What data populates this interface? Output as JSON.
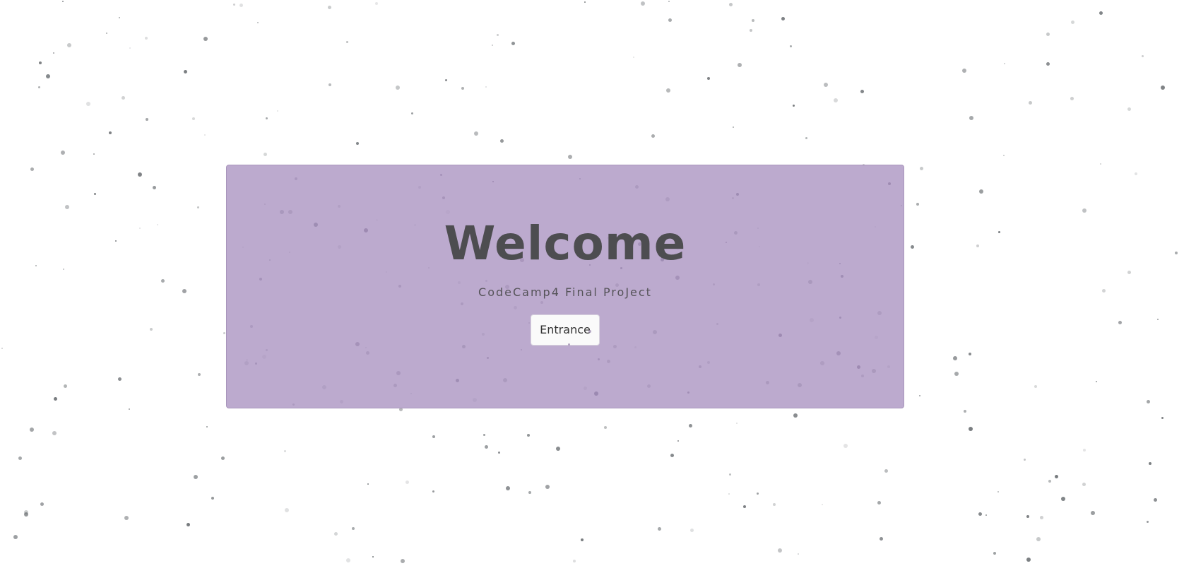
{
  "welcome": {
    "title": "Welcome",
    "subtitle": "CodeCamp4 Final ProJect",
    "button_label": "Entrance"
  },
  "colors": {
    "background": "#ffffff",
    "jumbotron": "#bdacce",
    "particle": "#555a5e",
    "title_text": "#4d4d50"
  }
}
